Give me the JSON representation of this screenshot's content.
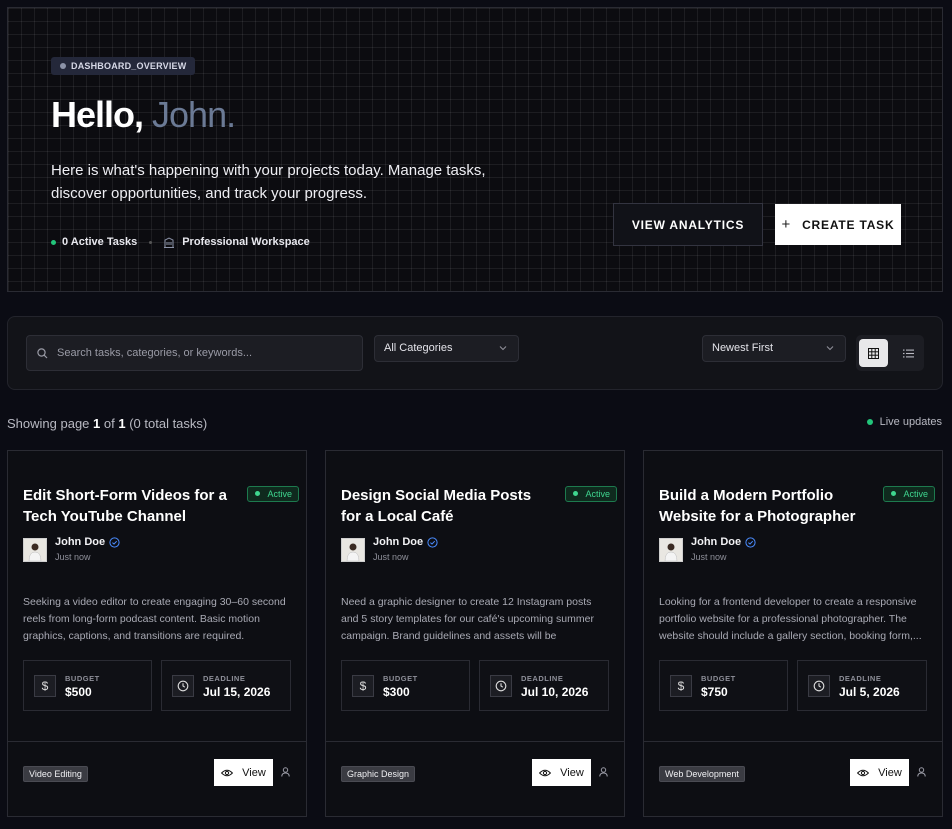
{
  "hero": {
    "badge": "DASHBOARD_OVERVIEW",
    "greeting": "Hello,",
    "name": "John.",
    "description": "Here is what's happening with your projects today. Manage tasks, discover opportunities, and track your progress.",
    "active_tasks": "0 Active Tasks",
    "workspace": "Professional Workspace",
    "btn_analytics": "VIEW ANALYTICS",
    "btn_create": "CREATE TASK"
  },
  "filters": {
    "search_placeholder": "Search tasks, categories, or keywords...",
    "category": "All Categories",
    "sort": "Newest First"
  },
  "status": {
    "showing_prefix": "Showing page",
    "page": "1",
    "of": "of",
    "total_pages": "1",
    "total": "(0 total tasks)",
    "live": "Live updates"
  },
  "colors": {
    "accent_green": "#22c57a",
    "background": "#0b0c14"
  },
  "tasks": [
    {
      "title": "Edit Short-Form Videos for a Tech YouTube Channel",
      "status": "Active",
      "author": "John Doe",
      "posted": "Just now",
      "description": "Seeking a video editor to create engaging 30–60 second reels from long-form podcast content. Basic motion graphics, captions, and transitions are required. Potentia...",
      "budget_label": "BUDGET",
      "budget": "$500",
      "deadline_label": "DEADLINE",
      "deadline": "Jul 15, 2026",
      "category": "Video Editing",
      "view_label": "View"
    },
    {
      "title": "Design Social Media Posts for a Local Café",
      "status": "Active",
      "author": "John Doe",
      "posted": "Just now",
      "description": "Need a graphic designer to create 12 Instagram posts and 5 story templates for our café's upcoming summer campaign. Brand guidelines and assets will be provided....",
      "budget_label": "BUDGET",
      "budget": "$300",
      "deadline_label": "DEADLINE",
      "deadline": "Jul 10, 2026",
      "category": "Graphic Design",
      "view_label": "View"
    },
    {
      "title": "Build a Modern Portfolio Website for a Photographer",
      "status": "Active",
      "author": "John Doe",
      "posted": "Just now",
      "description": "Looking for a frontend developer to create a responsive portfolio website for a professional photographer. The website should include a gallery section, booking form,...",
      "budget_label": "BUDGET",
      "budget": "$750",
      "deadline_label": "DEADLINE",
      "deadline": "Jul 5, 2026",
      "category": "Web Development",
      "view_label": "View"
    }
  ]
}
